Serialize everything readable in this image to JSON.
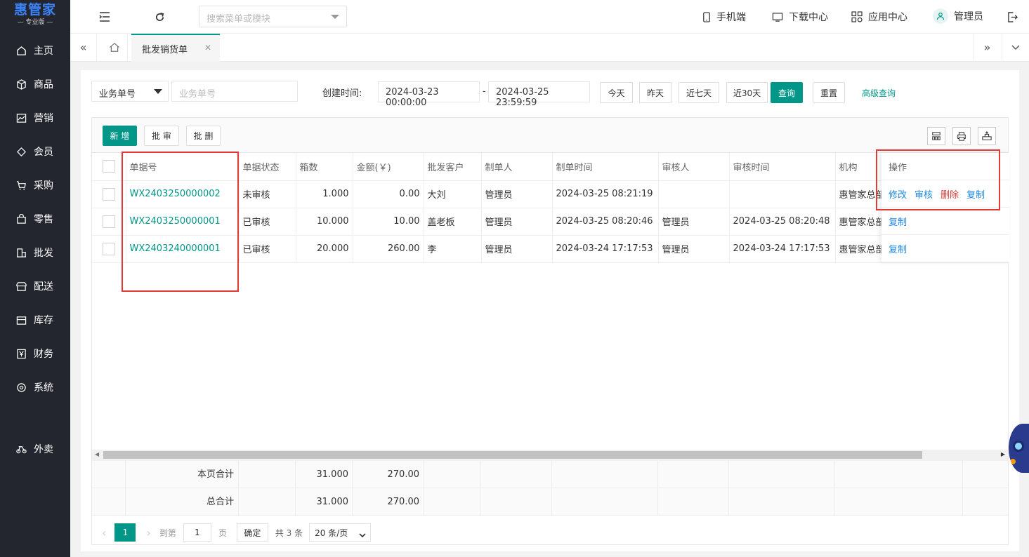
{
  "sidebar": {
    "brand": "惠管家",
    "edition": "专业版",
    "items": [
      {
        "label": "主页",
        "icon": "home-icon"
      },
      {
        "label": "商品",
        "icon": "box-icon"
      },
      {
        "label": "营销",
        "icon": "chart-icon"
      },
      {
        "label": "会员",
        "icon": "diamond-icon"
      },
      {
        "label": "采购",
        "icon": "cart-icon"
      },
      {
        "label": "零售",
        "icon": "bag-icon"
      },
      {
        "label": "批发",
        "icon": "building-icon"
      },
      {
        "label": "配送",
        "icon": "store-icon"
      },
      {
        "label": "库存",
        "icon": "archive-icon"
      },
      {
        "label": "财务",
        "icon": "yen-icon"
      },
      {
        "label": "系统",
        "icon": "settings-icon"
      },
      {
        "label": "外卖",
        "icon": "bike-icon"
      }
    ]
  },
  "topbar": {
    "search_placeholder": "搜索菜单或模块",
    "mobile": "手机端",
    "download": "下载中心",
    "apps": "应用中心",
    "user": "管理员"
  },
  "tabs": {
    "active": "批发销货单"
  },
  "filter": {
    "type_select": "业务单号",
    "doc_placeholder": "业务单号",
    "created_label": "创建时间:",
    "date_from": "2024-03-23 00:00:00",
    "date_sep": "-",
    "date_to": "2024-03-25 23:59:59",
    "today": "今天",
    "yesterday": "昨天",
    "last7": "近七天",
    "last30": "近30天",
    "query": "查询",
    "reset": "重置",
    "advanced": "高级查询"
  },
  "toolbar": {
    "add": "新 增",
    "batch_audit": "批 审",
    "batch_delete": "批 删"
  },
  "table": {
    "headers": [
      "单据号",
      "单据状态",
      "箱数",
      "金额(￥)",
      "批发客户",
      "制单人",
      "制单时间",
      "审核人",
      "审核时间",
      "机构",
      "操作"
    ],
    "rows": [
      {
        "no": "WX2403250000002",
        "status": "未审核",
        "boxes": "1.000",
        "amount": "0.00",
        "customer": "大刘",
        "creator": "管理员",
        "created": "2024-03-25 08:21:19",
        "auditor": "",
        "audited": "",
        "org": "惠管家总部"
      },
      {
        "no": "WX2403250000001",
        "status": "已审核",
        "boxes": "10.000",
        "amount": "10.00",
        "customer": "盖老板",
        "creator": "管理员",
        "created": "2024-03-25 08:20:46",
        "auditor": "管理员",
        "audited": "2024-03-25 08:20:48",
        "org": "惠管家总部"
      },
      {
        "no": "WX2403240000001",
        "status": "已审核",
        "boxes": "20.000",
        "amount": "260.00",
        "customer": "李",
        "creator": "管理员",
        "created": "2024-03-24 17:17:53",
        "auditor": "管理员",
        "audited": "2024-03-24 17:17:53",
        "org": "惠管家总部"
      }
    ],
    "ops": {
      "edit": "修改",
      "audit": "审核",
      "delete": "删除",
      "copy": "复制"
    },
    "page_total_label": "本页合计",
    "grand_total_label": "总合计",
    "page_boxes": "31.000",
    "page_amount": "270.00",
    "total_boxes": "31.000",
    "total_amount": "270.00"
  },
  "pager": {
    "current": "1",
    "goto": "到第",
    "page_input": "1",
    "page_unit": "页",
    "confirm": "确定",
    "total": "共 3 条",
    "size": "20 条/页"
  },
  "colors": {
    "accent": "#009688",
    "sidebar": "#23262e",
    "link": "#1e88e5",
    "danger": "#e53935"
  }
}
